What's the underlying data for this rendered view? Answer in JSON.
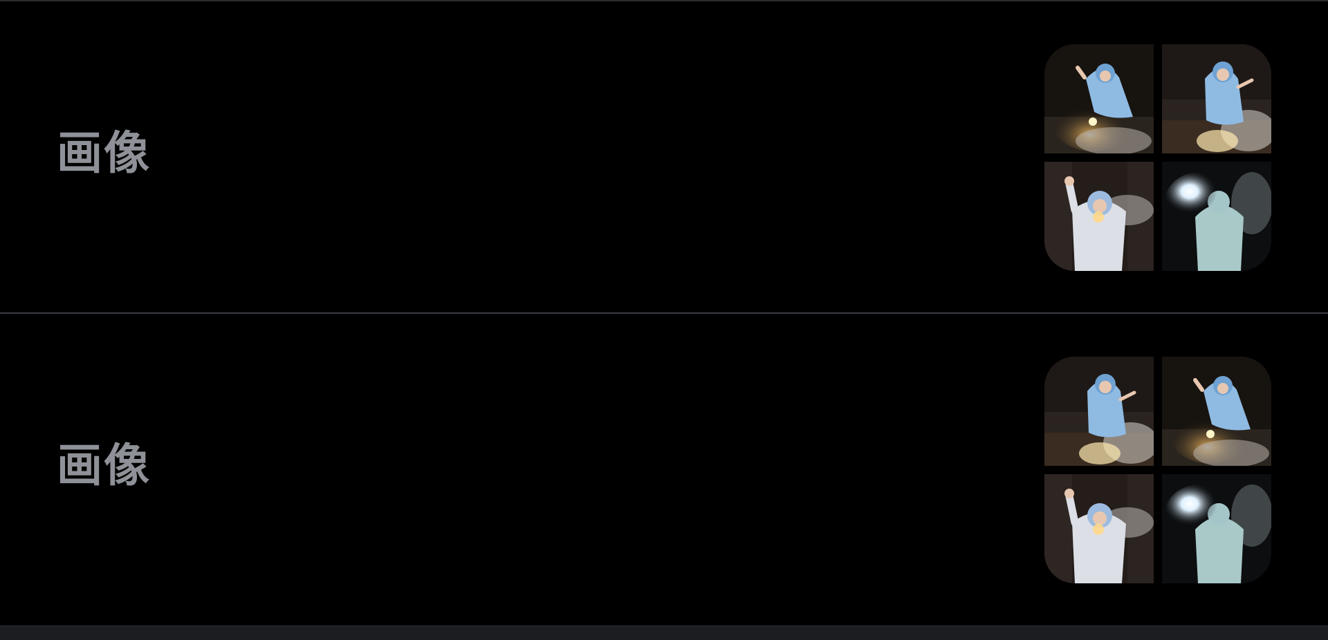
{
  "rows": [
    {
      "label": "画像",
      "thumbnails": [
        {
          "icon": "photo-crouching-sparkler"
        },
        {
          "icon": "photo-crouching-smoke"
        },
        {
          "icon": "photo-standing-fist"
        },
        {
          "icon": "photo-standing-bright-light"
        }
      ]
    },
    {
      "label": "画像",
      "thumbnails": [
        {
          "icon": "photo-crouching-smoke"
        },
        {
          "icon": "photo-crouching-sparkler"
        },
        {
          "icon": "photo-standing-fist"
        },
        {
          "icon": "photo-standing-bright-light"
        }
      ]
    }
  ],
  "colors": {
    "background": "#000000",
    "label": "#8e9197",
    "divider": "#3a3d42",
    "hoodie": "#8fbbe3"
  }
}
